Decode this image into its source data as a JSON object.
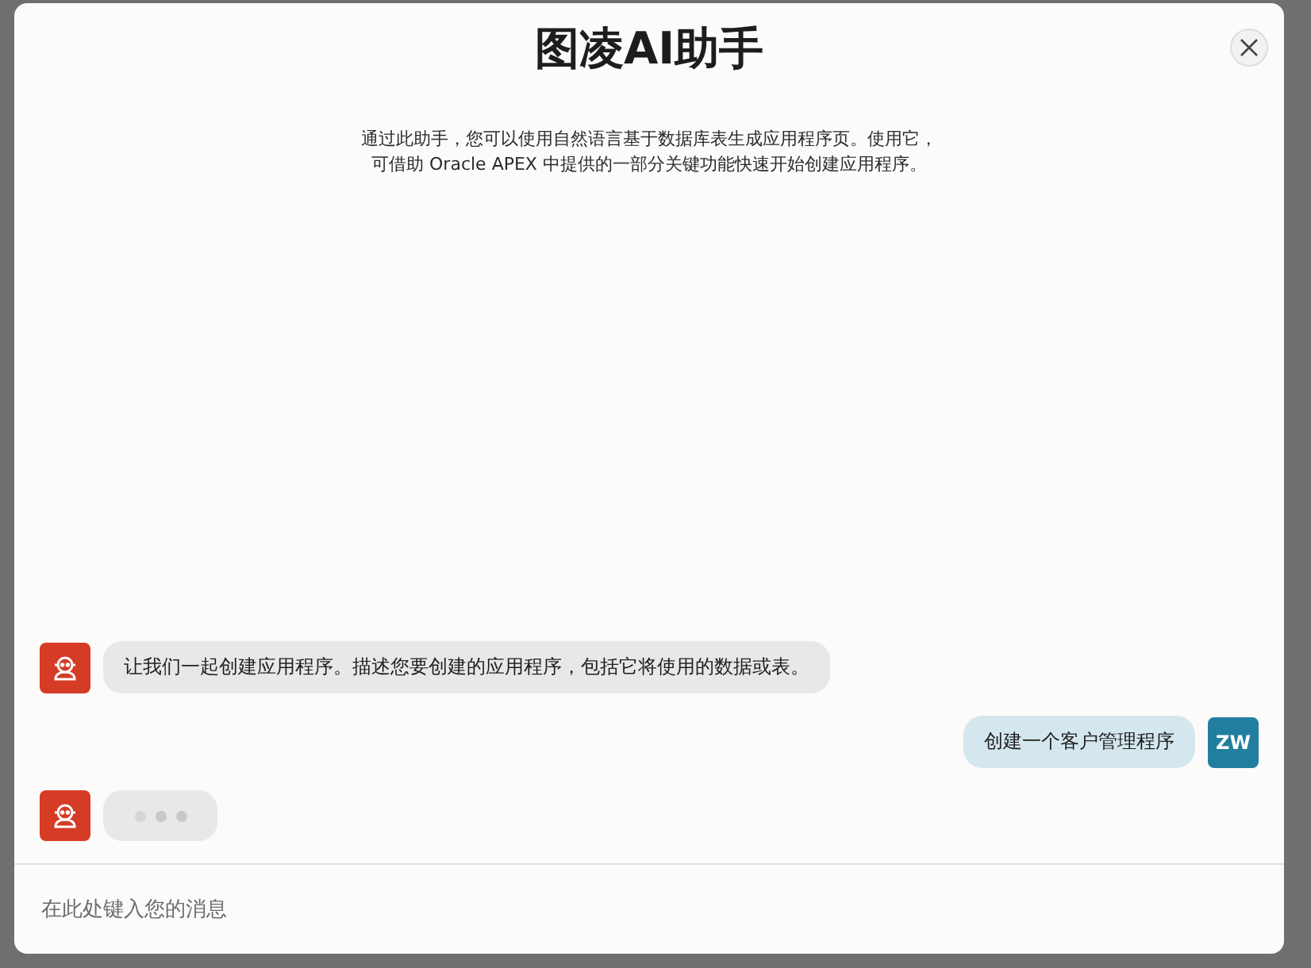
{
  "dialog": {
    "title": "图凌AI助手",
    "description_lines": [
      "通过此助手，您可以使用自然语言基于数据库表生成应用程序页。使用它，",
      "可借助 Oracle APEX 中提供的一部分关键功能快速开始创建应用程序。"
    ]
  },
  "messages": [
    {
      "kind": "assistant",
      "text": "让我们一起创建应用程序。描述您要创建的应用程序，包括它将使用的数据或表。"
    },
    {
      "kind": "user",
      "text": "创建一个客户管理程序",
      "avatar": "ZW"
    },
    {
      "kind": "typing"
    }
  ],
  "composer": {
    "placeholder": "在此处键入您的消息"
  }
}
